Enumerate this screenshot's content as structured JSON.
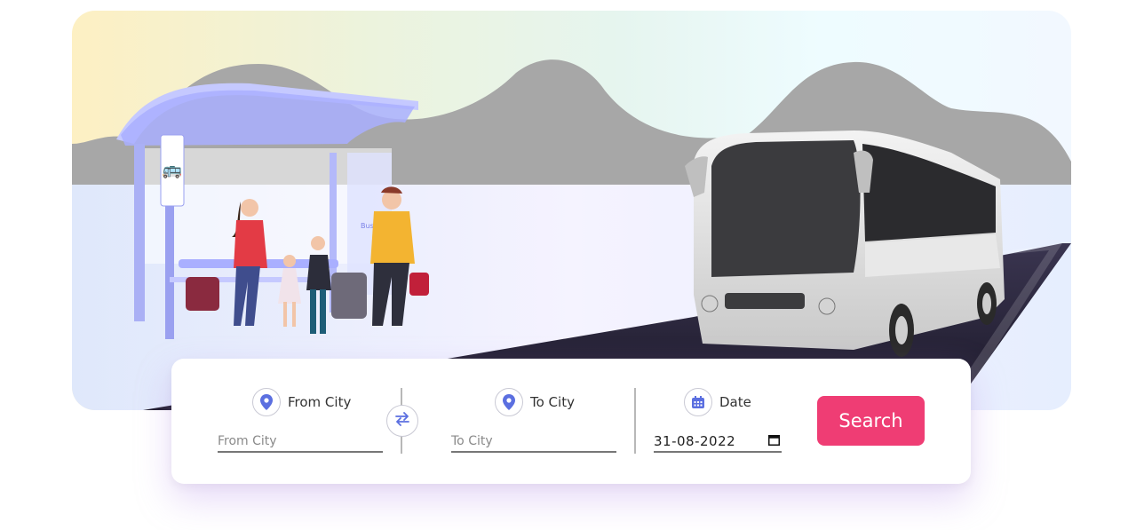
{
  "search": {
    "from": {
      "label": "From City",
      "placeholder": "From City",
      "icon": "location-pin-icon"
    },
    "to": {
      "label": "To City",
      "placeholder": "To City",
      "icon": "location-pin-icon"
    },
    "date": {
      "label": "Date",
      "value": "31-08-2022",
      "icon": "calendar-icon"
    },
    "swap_icon": "swap-arrows-icon",
    "button_label": "Search"
  },
  "illustration": {
    "bus_stop_sign": "Bus Stop"
  },
  "colors": {
    "accent": "#ef3d74",
    "icon_blue": "#5b6fe0",
    "shelter": "#aab0f5"
  }
}
